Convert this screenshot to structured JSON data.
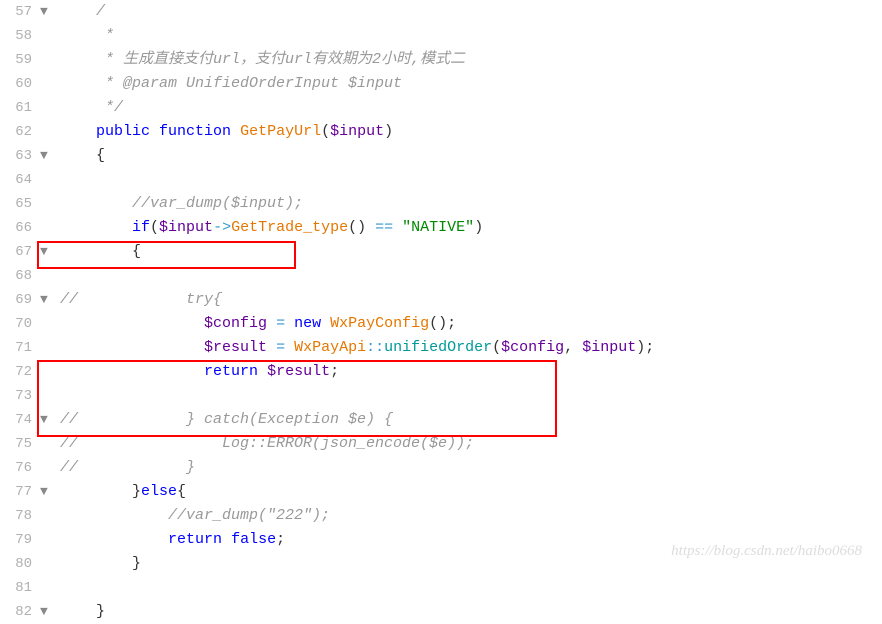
{
  "watermark": "https://blog.csdn.net/haibo0668",
  "lines": [
    {
      "num": "57",
      "fold": "▼",
      "seg": [
        {
          "c": "comment",
          "t": "    /"
        }
      ]
    },
    {
      "num": "58",
      "fold": "",
      "seg": [
        {
          "c": "comment",
          "t": "     *"
        }
      ]
    },
    {
      "num": "59",
      "fold": "",
      "seg": [
        {
          "c": "comment",
          "t": "     * 生成直接支付url，支付url有效期为2小时,模式二"
        }
      ]
    },
    {
      "num": "60",
      "fold": "",
      "seg": [
        {
          "c": "comment",
          "t": "     * @param UnifiedOrderInput $input"
        }
      ]
    },
    {
      "num": "61",
      "fold": "",
      "seg": [
        {
          "c": "comment",
          "t": "     */"
        }
      ]
    },
    {
      "num": "62",
      "fold": "",
      "seg": [
        {
          "c": "",
          "t": "    "
        },
        {
          "c": "keyword",
          "t": "public"
        },
        {
          "c": "",
          "t": " "
        },
        {
          "c": "keyword",
          "t": "function"
        },
        {
          "c": "",
          "t": " "
        },
        {
          "c": "orange",
          "t": "GetPayUrl"
        },
        {
          "c": "brace",
          "t": "("
        },
        {
          "c": "variable",
          "t": "$input"
        },
        {
          "c": "brace",
          "t": ")"
        }
      ]
    },
    {
      "num": "63",
      "fold": "▼",
      "seg": [
        {
          "c": "brace",
          "t": "    {"
        }
      ]
    },
    {
      "num": "64",
      "fold": "",
      "seg": [
        {
          "c": "",
          "t": ""
        }
      ]
    },
    {
      "num": "65",
      "fold": "",
      "seg": [
        {
          "c": "",
          "t": "        "
        },
        {
          "c": "comment",
          "t": "//var_dump($input);"
        }
      ]
    },
    {
      "num": "66",
      "fold": "",
      "seg": [
        {
          "c": "",
          "t": "        "
        },
        {
          "c": "keyword",
          "t": "if"
        },
        {
          "c": "brace",
          "t": "("
        },
        {
          "c": "variable",
          "t": "$input"
        },
        {
          "c": "operator",
          "t": "->"
        },
        {
          "c": "orange",
          "t": "GetTrade_type"
        },
        {
          "c": "brace",
          "t": "()"
        },
        {
          "c": "",
          "t": " "
        },
        {
          "c": "operator",
          "t": "=="
        },
        {
          "c": "",
          "t": " "
        },
        {
          "c": "string",
          "t": "\"NATIVE\""
        },
        {
          "c": "brace",
          "t": ")"
        }
      ]
    },
    {
      "num": "67",
      "fold": "▼",
      "seg": [
        {
          "c": "brace",
          "t": "        {"
        }
      ]
    },
    {
      "num": "68",
      "fold": "",
      "seg": [
        {
          "c": "",
          "t": ""
        }
      ]
    },
    {
      "num": "69",
      "fold": "▼",
      "seg": [
        {
          "c": "comment",
          "t": "//            try{"
        }
      ]
    },
    {
      "num": "70",
      "fold": "",
      "seg": [
        {
          "c": "",
          "t": "                "
        },
        {
          "c": "variable",
          "t": "$config"
        },
        {
          "c": "",
          "t": " "
        },
        {
          "c": "operator",
          "t": "="
        },
        {
          "c": "",
          "t": " "
        },
        {
          "c": "keyword",
          "t": "new"
        },
        {
          "c": "",
          "t": " "
        },
        {
          "c": "orange",
          "t": "WxPayConfig"
        },
        {
          "c": "brace",
          "t": "();"
        }
      ]
    },
    {
      "num": "71",
      "fold": "",
      "seg": [
        {
          "c": "",
          "t": "                "
        },
        {
          "c": "variable",
          "t": "$result"
        },
        {
          "c": "",
          "t": " "
        },
        {
          "c": "operator",
          "t": "="
        },
        {
          "c": "",
          "t": " "
        },
        {
          "c": "orange",
          "t": "WxPayApi"
        },
        {
          "c": "operator",
          "t": "::"
        },
        {
          "c": "static-call",
          "t": "unifiedOrder"
        },
        {
          "c": "brace",
          "t": "("
        },
        {
          "c": "variable",
          "t": "$config"
        },
        {
          "c": "brace",
          "t": ", "
        },
        {
          "c": "variable",
          "t": "$input"
        },
        {
          "c": "brace",
          "t": ");"
        }
      ]
    },
    {
      "num": "72",
      "fold": "",
      "seg": [
        {
          "c": "",
          "t": "                "
        },
        {
          "c": "keyword",
          "t": "return"
        },
        {
          "c": "",
          "t": " "
        },
        {
          "c": "variable",
          "t": "$result"
        },
        {
          "c": "brace",
          "t": ";"
        }
      ]
    },
    {
      "num": "73",
      "fold": "",
      "seg": [
        {
          "c": "",
          "t": ""
        }
      ]
    },
    {
      "num": "74",
      "fold": "▼",
      "seg": [
        {
          "c": "comment",
          "t": "//            } catch(Exception $e) {"
        }
      ]
    },
    {
      "num": "75",
      "fold": "",
      "seg": [
        {
          "c": "comment",
          "t": "//                Log::ERROR(json_encode($e));"
        }
      ]
    },
    {
      "num": "76",
      "fold": "",
      "seg": [
        {
          "c": "comment",
          "t": "//            }"
        }
      ]
    },
    {
      "num": "77",
      "fold": "▼",
      "seg": [
        {
          "c": "brace",
          "t": "        }"
        },
        {
          "c": "keyword",
          "t": "else"
        },
        {
          "c": "brace",
          "t": "{"
        }
      ]
    },
    {
      "num": "78",
      "fold": "",
      "seg": [
        {
          "c": "",
          "t": "            "
        },
        {
          "c": "comment",
          "t": "//var_dump(\"222\");"
        }
      ]
    },
    {
      "num": "79",
      "fold": "",
      "seg": [
        {
          "c": "",
          "t": "            "
        },
        {
          "c": "keyword",
          "t": "return"
        },
        {
          "c": "",
          "t": " "
        },
        {
          "c": "keyword",
          "t": "false"
        },
        {
          "c": "brace",
          "t": ";"
        }
      ]
    },
    {
      "num": "80",
      "fold": "",
      "seg": [
        {
          "c": "brace",
          "t": "        }"
        }
      ]
    },
    {
      "num": "81",
      "fold": "",
      "seg": [
        {
          "c": "",
          "t": ""
        }
      ]
    },
    {
      "num": "82",
      "fold": "▼",
      "seg": [
        {
          "c": "brace",
          "t": "    }"
        }
      ]
    }
  ]
}
